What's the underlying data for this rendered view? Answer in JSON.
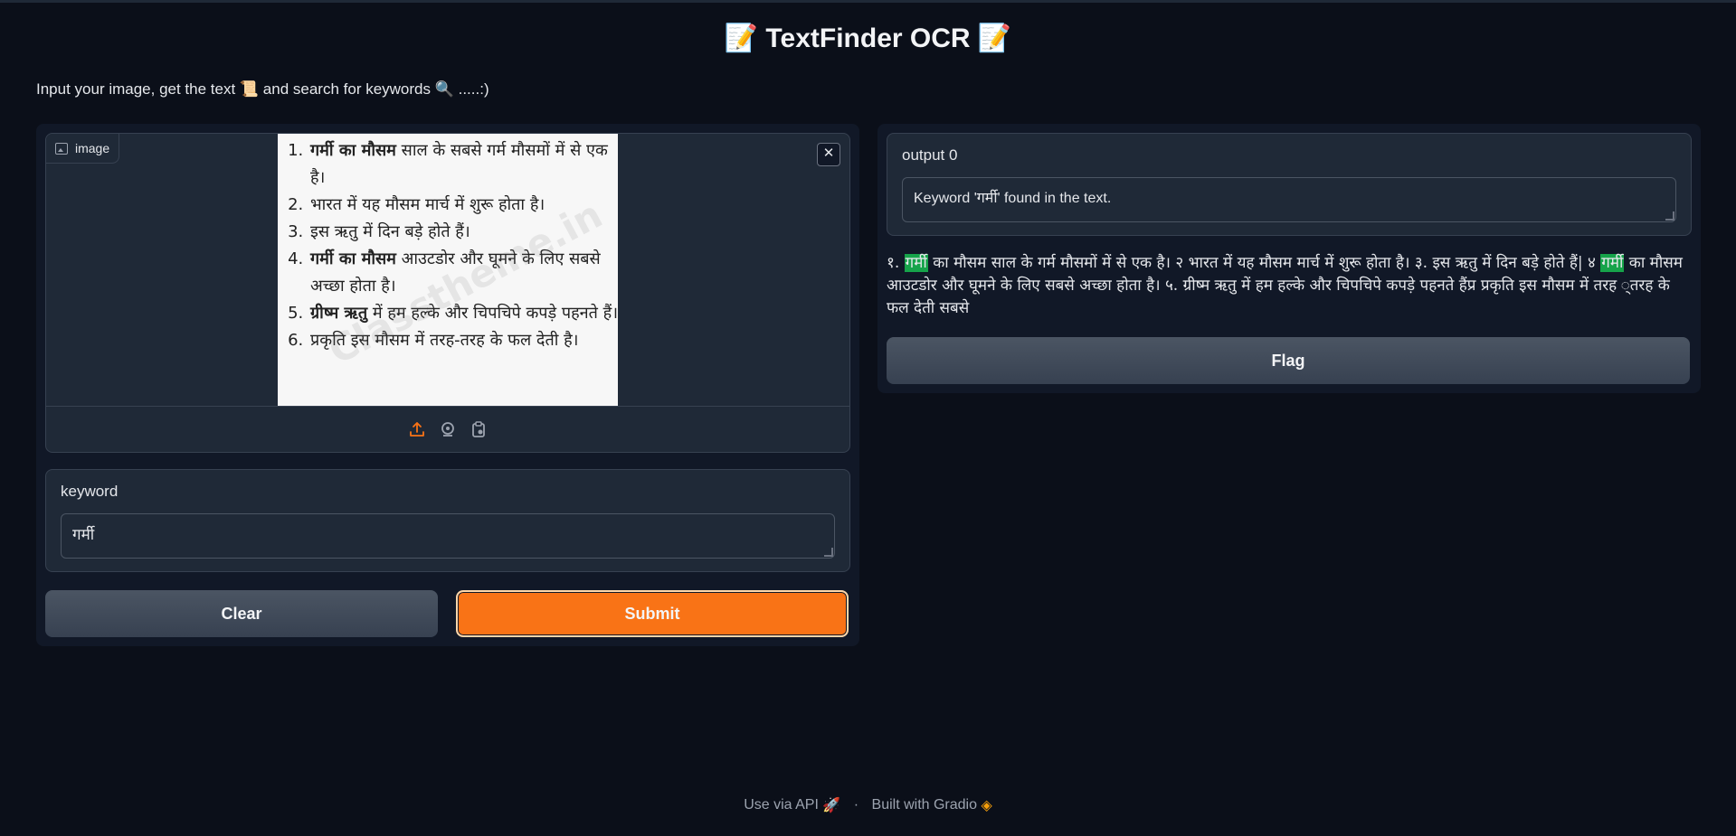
{
  "header": {
    "title": "📝 TextFinder OCR 📝",
    "description": "Input your image, get the text 📜 and search for keywords 🔍 .....:)"
  },
  "input_image": {
    "label": "image",
    "close_label": "✕",
    "preview_lines": [
      {
        "bold": "गर्मी का मौसम",
        "rest": " साल के सबसे गर्म मौसमों में से एक है।"
      },
      {
        "bold": "",
        "rest": "भारत में यह मौसम मार्च में शुरू होता है।"
      },
      {
        "bold": "",
        "rest": "इस ऋतु में दिन बड़े होते हैं।"
      },
      {
        "bold": "गर्मी का मौसम",
        "rest": " आउटडोर और घूमने के लिए सबसे अच्छा होता है।"
      },
      {
        "bold": "ग्रीष्म ऋतु",
        "rest": " में हम हल्के और चिपचिपे कपड़े पहनते हैं।"
      },
      {
        "bold": "",
        "rest": "प्रकृति इस मौसम में तरह-तरह के फल देती है।"
      }
    ],
    "watermark": "Classtheme.in",
    "sources": [
      "upload-icon",
      "webcam-icon",
      "clipboard-icon"
    ]
  },
  "keyword": {
    "label": "keyword",
    "value": "गर्मी"
  },
  "buttons": {
    "clear": "Clear",
    "submit": "Submit",
    "flag": "Flag"
  },
  "output": {
    "label": "output 0",
    "value": "Keyword 'गर्मी' found in the text.",
    "highlighted_segments": [
      {
        "text": "१. ",
        "hl": false
      },
      {
        "text": "गर्मी",
        "hl": true
      },
      {
        "text": " का मौसम साल के गर्म मौसमों में से एक है। २ भारत में यह मौसम मार्च में शुरू होता है। ३. इस ऋतु में दिन बड़े होते हैं| ४ ",
        "hl": false
      },
      {
        "text": "गर्मी",
        "hl": true
      },
      {
        "text": " का मौसम आउटडोर और घूमने के लिए सबसे अच्छा होता है। ५. ग्रीष्म ऋतु में हम हल्के और चिपचिपे कपड़े पहनते हैंप्र प्रकृति इस मौसम में तरह ्तरह के फल देती सबसे",
        "hl": false
      }
    ]
  },
  "footer": {
    "api": "Use via API",
    "separator": "·",
    "built": "Built with Gradio"
  },
  "colors": {
    "background": "#0b0f19",
    "panel": "#111827",
    "block": "#1f2937",
    "accent": "#f97316",
    "highlight": "#16a34a"
  }
}
